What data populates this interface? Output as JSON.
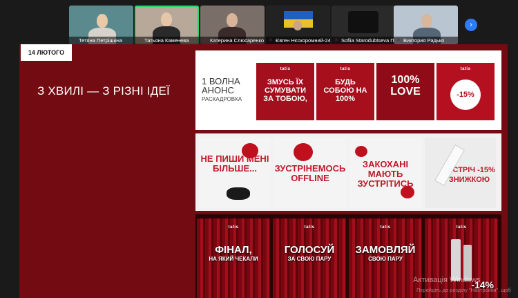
{
  "participants": [
    {
      "name": "Тетяна Петрішина",
      "active": false
    },
    {
      "name": "Татьяна Каменева",
      "active": true
    },
    {
      "name": "Катерина Слюсаренко",
      "active": false
    },
    {
      "name": "Євген Нєскоромний-24ск",
      "active": false
    },
    {
      "name": "Sofiia Starodubtseva П...",
      "active": false
    },
    {
      "name": "Виктория Радько",
      "active": false
    }
  ],
  "next_glyph": "›",
  "slide": {
    "date_badge": "14 ЛЮТОГО",
    "title": "З ХВИЛІ — З РІЗНІ ІДЕЇ",
    "wave_label_line1": "1 ВОЛНА",
    "wave_label_line2": "АНОНС",
    "wave_label_line3": "РАСКАДРОВКА",
    "row1_cards": [
      {
        "brand": "tatis",
        "text": "ЗМУСЬ ЇХ СУМУВАТИ ЗА ТОБОЮ,"
      },
      {
        "brand": "tatis",
        "text": "БУДЬ СОБОЮ НА 100%"
      },
      {
        "brand": "",
        "text": "100% LOVE"
      },
      {
        "brand": "tatis",
        "sticker": "-15%"
      }
    ],
    "row2_cards": [
      {
        "text": "НЕ ПИШИ МЕНІ БІЛЬШЕ..."
      },
      {
        "text": "ЗУСТРІНЕМОСЬ OFFLINE"
      },
      {
        "text": "ЗАКОХАНІ МАЮТЬ ЗУСТРІТИСЬ"
      },
      {
        "text": "ЗУСТРІЧ -15% ЗНИЖКОЮ"
      }
    ],
    "row3_cards": [
      {
        "brand": "tatis",
        "title": "ФІНАЛ,",
        "sub": "НА ЯКИЙ ЧЕКАЛИ"
      },
      {
        "brand": "tatis",
        "title": "ГОЛОСУЙ",
        "sub": "ЗА СВОЮ ПАРУ"
      },
      {
        "brand": "tatis",
        "title": "ЗАМОВЛЯЙ",
        "sub": "СВОЮ ПАРУ"
      },
      {
        "brand": "tatis",
        "title": "-14%",
        "sub": ""
      }
    ]
  },
  "watermark": {
    "line1": "Активація Windows",
    "line2": "Перейдіть до розділу \"Настройки\", щоб"
  },
  "colors": {
    "slide_bg": "#730b12",
    "accent_red": "#a40f1d",
    "active_outline": "#2bd46a",
    "next_button": "#2d7bf5"
  }
}
